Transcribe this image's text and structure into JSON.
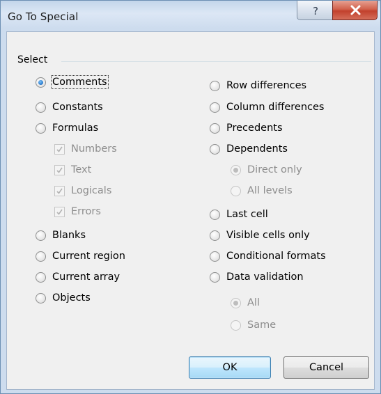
{
  "window": {
    "title": "Go To Special"
  },
  "titlebar": {
    "help_glyph": "?",
    "close_glyph": "x"
  },
  "group": {
    "label": "Select"
  },
  "left_column": [
    {
      "label": "Comments",
      "checked": true
    },
    {
      "label": "Constants"
    },
    {
      "label": "Formulas"
    },
    {
      "label": "Numbers",
      "sub": true,
      "checked": true
    },
    {
      "label": "Text",
      "sub": true,
      "checked": true
    },
    {
      "label": "Logicals",
      "sub": true,
      "checked": true
    },
    {
      "label": "Errors",
      "sub": true,
      "checked": true
    },
    {
      "label": "Blanks"
    },
    {
      "label": "Current region"
    },
    {
      "label": "Current array"
    },
    {
      "label": "Objects"
    }
  ],
  "right_column": [
    {
      "label": "Row differences"
    },
    {
      "label": "Column differences"
    },
    {
      "label": "Precedents"
    },
    {
      "label": "Dependents"
    },
    {
      "label": "Direct only",
      "sub": true,
      "checked": true
    },
    {
      "label": "All levels",
      "sub": true
    },
    {
      "label": "Last cell"
    },
    {
      "label": "Visible cells only"
    },
    {
      "label": "Conditional formats"
    },
    {
      "label": "Data validation"
    },
    {
      "label": "All",
      "sub": true,
      "checked": true
    },
    {
      "label": "Same",
      "sub": true
    }
  ],
  "buttons": {
    "ok": "OK",
    "cancel": "Cancel"
  },
  "colors": {
    "accent": "#2f7fd1",
    "close": "#c2412d",
    "disabled_text": "#8d8d8d"
  }
}
